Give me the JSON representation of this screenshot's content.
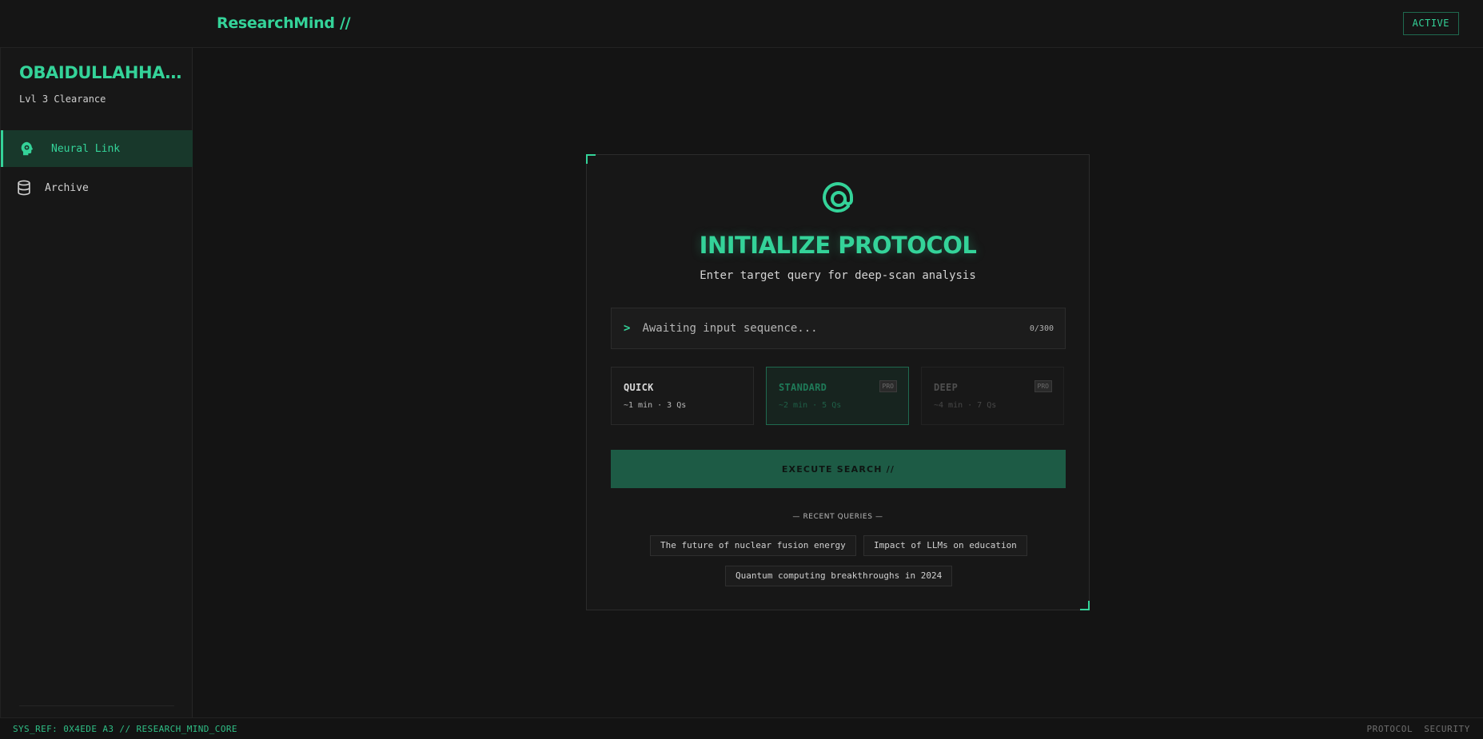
{
  "header": {
    "brand": "ResearchMind //",
    "status": "ACTIVE"
  },
  "sidebar": {
    "user_name": "OBAIDULLAHHA...",
    "clearance": "Lvl 3 Clearance",
    "items": [
      {
        "label": "Neural Link",
        "icon": "brain-icon",
        "active": true
      },
      {
        "label": "Archive",
        "icon": "database-icon",
        "active": false
      }
    ]
  },
  "panel": {
    "logo_icon": "at-sign-icon",
    "title": "INITIALIZE PROTOCOL",
    "subtitle": "Enter target query for deep-scan analysis",
    "query": {
      "prompt": ">",
      "placeholder": "Awaiting input sequence...",
      "value": "",
      "count": "0/300"
    },
    "modes": [
      {
        "name": "QUICK",
        "meta": "~1 min · 3 Qs",
        "pro": ""
      },
      {
        "name": "STANDARD",
        "meta": "~2 min · 5 Qs",
        "pro": "PRO"
      },
      {
        "name": "DEEP",
        "meta": "~4 min · 7 Qs",
        "pro": "PRO"
      }
    ],
    "execute_label": "EXECUTE SEARCH //",
    "recent_label": "— RECENT QUERIES —",
    "recent": [
      "The future of nuclear fusion energy",
      "Impact of LLMs on education",
      "Quantum computing breakthroughs in 2024"
    ]
  },
  "footer": {
    "sys_ref": "SYS_REF: 0X4EDE A3 // RESEARCH_MIND_CORE",
    "links": [
      "PROTOCOL",
      "SECURITY"
    ]
  },
  "colors": {
    "accent": "#34d399",
    "background": "#141414",
    "panel": "#171717",
    "button": "#1d5b45"
  }
}
